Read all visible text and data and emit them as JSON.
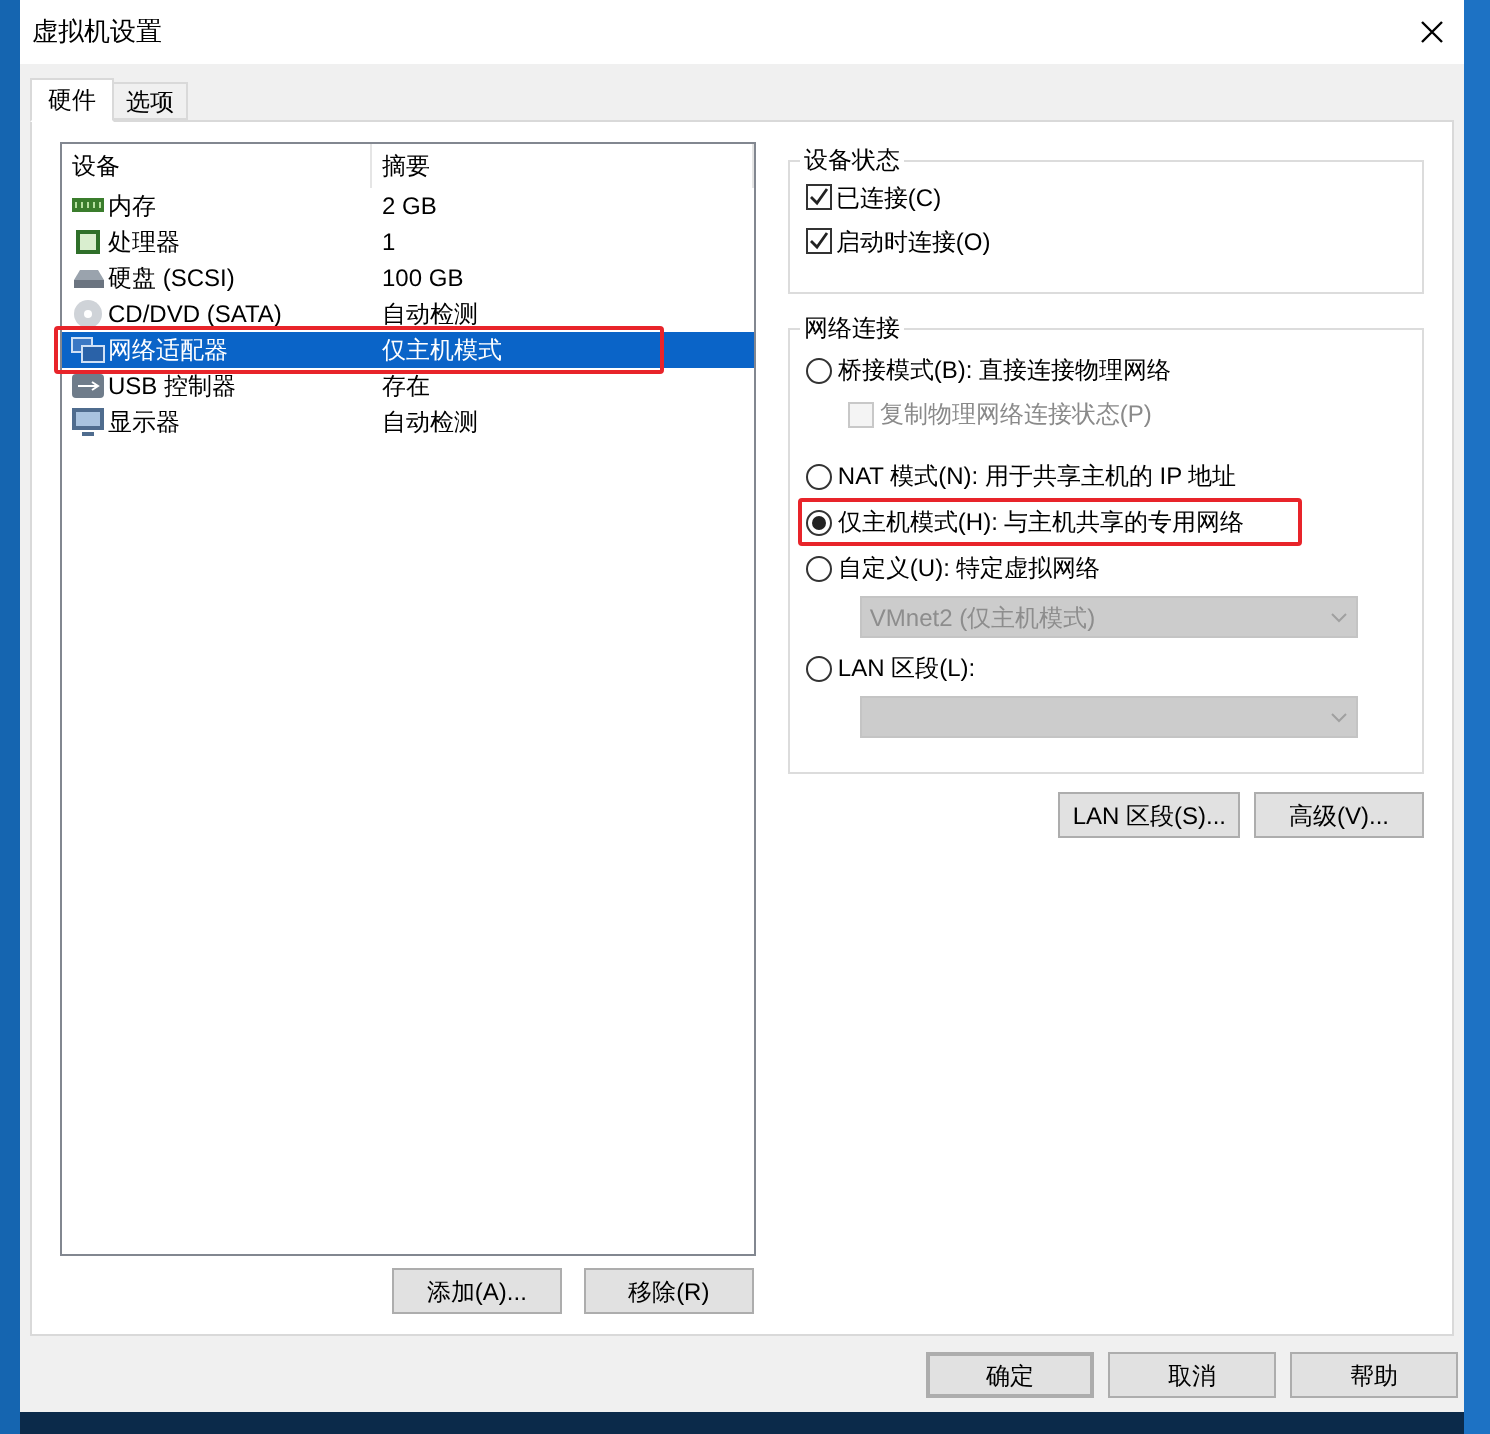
{
  "window": {
    "title": "虚拟机设置"
  },
  "tabs": [
    {
      "label": "硬件",
      "selected": true
    },
    {
      "label": "选项",
      "selected": false
    }
  ],
  "devices": {
    "columns": [
      "设备",
      "摘要"
    ],
    "rows": [
      {
        "kind": "memory",
        "name": "内存",
        "summary": "2 GB",
        "selected": false,
        "highlighted": false
      },
      {
        "kind": "cpu",
        "name": "处理器",
        "summary": "1",
        "selected": false,
        "highlighted": false
      },
      {
        "kind": "disk",
        "name": "硬盘 (SCSI)",
        "summary": "100 GB",
        "selected": false,
        "highlighted": false
      },
      {
        "kind": "cd",
        "name": "CD/DVD (SATA)",
        "summary": "自动检测",
        "selected": false,
        "highlighted": false
      },
      {
        "kind": "network",
        "name": "网络适配器",
        "summary": "仅主机模式",
        "selected": true,
        "highlighted": true
      },
      {
        "kind": "usb",
        "name": "USB 控制器",
        "summary": "存在",
        "selected": false,
        "highlighted": false
      },
      {
        "kind": "display",
        "name": "显示器",
        "summary": "自动检测",
        "selected": false,
        "highlighted": false
      }
    ]
  },
  "list_buttons": [
    "添加(A)...",
    "移除(R)"
  ],
  "device_status": {
    "title": "设备状态",
    "options": [
      {
        "label": "已连接(C)",
        "checked": true
      },
      {
        "label": "启动时连接(O)",
        "checked": true
      }
    ]
  },
  "network": {
    "title": "网络连接",
    "options": [
      {
        "kind": "radio",
        "label": "桥接模式(B): 直接连接物理网络",
        "selected": false,
        "highlighted": false
      },
      {
        "kind": "checkbox",
        "label": "复制物理网络连接状态(P)",
        "checked": false,
        "disabled": true
      },
      {
        "kind": "radio",
        "label": "NAT 模式(N): 用于共享主机的 IP 地址",
        "selected": false,
        "highlighted": false
      },
      {
        "kind": "radio",
        "label": "仅主机模式(H): 与主机共享的专用网络",
        "selected": true,
        "highlighted": true
      },
      {
        "kind": "radio",
        "label": "自定义(U): 特定虚拟网络",
        "selected": false,
        "highlighted": false
      },
      {
        "kind": "select",
        "value": "VMnet2 (仅主机模式)",
        "disabled": true
      },
      {
        "kind": "radio",
        "label": "LAN 区段(L):",
        "selected": false,
        "highlighted": false
      },
      {
        "kind": "select",
        "disabled": true
      }
    ]
  },
  "network_buttons": [
    "LAN 区段(S)...",
    "高级(V)..."
  ],
  "footer_buttons": [
    {
      "label": "确定",
      "default": true
    },
    {
      "label": "取消",
      "default": false
    },
    {
      "label": "帮助",
      "default": false
    }
  ]
}
